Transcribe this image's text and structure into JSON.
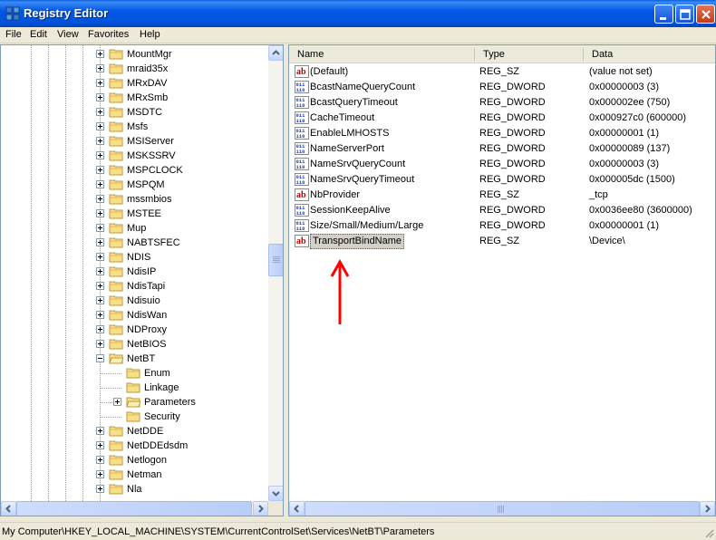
{
  "window": {
    "title": "Registry Editor"
  },
  "menu": [
    {
      "label": "File"
    },
    {
      "label": "Edit"
    },
    {
      "label": "View"
    },
    {
      "label": "Favorites"
    },
    {
      "label": "Help"
    }
  ],
  "tree": {
    "items": [
      {
        "label": "MountMgr",
        "level": 0,
        "expander": "plus"
      },
      {
        "label": "mraid35x",
        "level": 0,
        "expander": "plus"
      },
      {
        "label": "MRxDAV",
        "level": 0,
        "expander": "plus"
      },
      {
        "label": "MRxSmb",
        "level": 0,
        "expander": "plus"
      },
      {
        "label": "MSDTC",
        "level": 0,
        "expander": "plus"
      },
      {
        "label": "Msfs",
        "level": 0,
        "expander": "plus"
      },
      {
        "label": "MSIServer",
        "level": 0,
        "expander": "plus"
      },
      {
        "label": "MSKSSRV",
        "level": 0,
        "expander": "plus"
      },
      {
        "label": "MSPCLOCK",
        "level": 0,
        "expander": "plus"
      },
      {
        "label": "MSPQM",
        "level": 0,
        "expander": "plus"
      },
      {
        "label": "mssmbios",
        "level": 0,
        "expander": "plus"
      },
      {
        "label": "MSTEE",
        "level": 0,
        "expander": "plus"
      },
      {
        "label": "Mup",
        "level": 0,
        "expander": "plus"
      },
      {
        "label": "NABTSFEC",
        "level": 0,
        "expander": "plus"
      },
      {
        "label": "NDIS",
        "level": 0,
        "expander": "plus"
      },
      {
        "label": "NdisIP",
        "level": 0,
        "expander": "plus"
      },
      {
        "label": "NdisTapi",
        "level": 0,
        "expander": "plus"
      },
      {
        "label": "Ndisuio",
        "level": 0,
        "expander": "plus"
      },
      {
        "label": "NdisWan",
        "level": 0,
        "expander": "plus"
      },
      {
        "label": "NDProxy",
        "level": 0,
        "expander": "plus"
      },
      {
        "label": "NetBIOS",
        "level": 0,
        "expander": "plus"
      },
      {
        "label": "NetBT",
        "level": 0,
        "expander": "minus",
        "open": true
      },
      {
        "label": "Enum",
        "level": 1,
        "expander": "none"
      },
      {
        "label": "Linkage",
        "level": 1,
        "expander": "none"
      },
      {
        "label": "Parameters",
        "level": 1,
        "expander": "plus",
        "open": true
      },
      {
        "label": "Security",
        "level": 1,
        "expander": "none"
      },
      {
        "label": "NetDDE",
        "level": 0,
        "expander": "plus"
      },
      {
        "label": "NetDDEdsdm",
        "level": 0,
        "expander": "plus"
      },
      {
        "label": "Netlogon",
        "level": 0,
        "expander": "plus"
      },
      {
        "label": "Netman",
        "level": 0,
        "expander": "plus"
      },
      {
        "label": "Nla",
        "level": 0,
        "expander": "plus"
      }
    ]
  },
  "list": {
    "columns": [
      {
        "label": "Name"
      },
      {
        "label": "Type"
      },
      {
        "label": "Data"
      }
    ],
    "rows": [
      {
        "icon": "string-value-icon",
        "name": "(Default)",
        "type": "REG_SZ",
        "data": "(value not set)"
      },
      {
        "icon": "binary-value-icon",
        "name": "BcastNameQueryCount",
        "type": "REG_DWORD",
        "data": "0x00000003 (3)"
      },
      {
        "icon": "binary-value-icon",
        "name": "BcastQueryTimeout",
        "type": "REG_DWORD",
        "data": "0x000002ee (750)"
      },
      {
        "icon": "binary-value-icon",
        "name": "CacheTimeout",
        "type": "REG_DWORD",
        "data": "0x000927c0 (600000)"
      },
      {
        "icon": "binary-value-icon",
        "name": "EnableLMHOSTS",
        "type": "REG_DWORD",
        "data": "0x00000001 (1)"
      },
      {
        "icon": "binary-value-icon",
        "name": "NameServerPort",
        "type": "REG_DWORD",
        "data": "0x00000089 (137)"
      },
      {
        "icon": "binary-value-icon",
        "name": "NameSrvQueryCount",
        "type": "REG_DWORD",
        "data": "0x00000003 (3)"
      },
      {
        "icon": "binary-value-icon",
        "name": "NameSrvQueryTimeout",
        "type": "REG_DWORD",
        "data": "0x000005dc (1500)"
      },
      {
        "icon": "string-value-icon",
        "name": "NbProvider",
        "type": "REG_SZ",
        "data": "_tcp"
      },
      {
        "icon": "binary-value-icon",
        "name": "SessionKeepAlive",
        "type": "REG_DWORD",
        "data": "0x0036ee80 (3600000)"
      },
      {
        "icon": "binary-value-icon",
        "name": "Size/Small/Medium/Large",
        "type": "REG_DWORD",
        "data": "0x00000001 (1)"
      },
      {
        "icon": "string-value-icon",
        "name": "TransportBindName",
        "type": "REG_SZ",
        "data": "\\Device\\",
        "selected": true
      }
    ]
  },
  "annotation": {
    "arrow_color": "#ff0000"
  },
  "status": {
    "path": "My Computer\\HKEY_LOCAL_MACHINE\\SYSTEM\\CurrentControlSet\\Services\\NetBT\\Parameters"
  }
}
